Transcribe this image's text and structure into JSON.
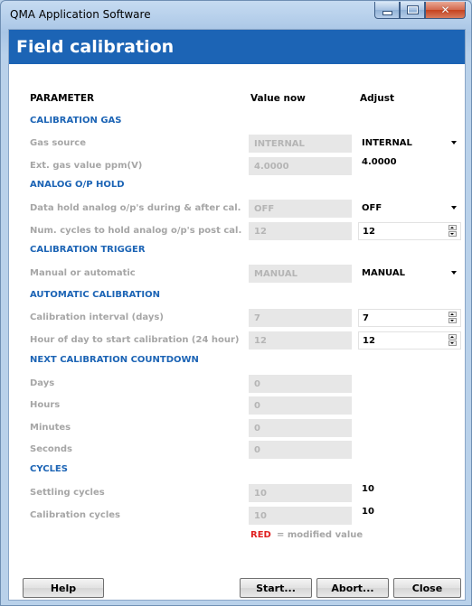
{
  "window": {
    "app_title": "QMA Application Software",
    "minimize": "minimize-icon",
    "maximize": "maximize-icon",
    "close": "close-icon"
  },
  "header": {
    "title": "Field calibration"
  },
  "columns": {
    "parameter": "PARAMETER",
    "value_now": "Value now",
    "adjust": "Adjust"
  },
  "sections": {
    "calibration_gas": "CALIBRATION GAS",
    "analog_hold": "ANALOG O/P HOLD",
    "calibration_trigger": "CALIBRATION TRIGGER",
    "automatic_calibration": "AUTOMATIC CALIBRATION",
    "next_countdown": "NEXT CALIBRATION COUNTDOWN",
    "cycles": "CYCLES"
  },
  "params": {
    "gas_source": {
      "label": "Gas source",
      "value_now": "INTERNAL",
      "adjust": "INTERNAL",
      "adjust_options": [
        "INTERNAL"
      ]
    },
    "ext_gas": {
      "label": "Ext. gas value ppm(V)",
      "value_now": "4.0000",
      "adjust": "4.0000"
    },
    "data_hold": {
      "label": "Data hold analog o/p's during & after cal.",
      "value_now": "OFF",
      "adjust": "OFF",
      "adjust_options": [
        "OFF"
      ]
    },
    "num_cycles_hold": {
      "label": "Num. cycles to hold analog o/p's post cal.",
      "value_now": "12",
      "adjust": "12"
    },
    "manual_auto": {
      "label": "Manual or automatic",
      "value_now": "MANUAL",
      "adjust": "MANUAL",
      "adjust_options": [
        "MANUAL"
      ]
    },
    "cal_interval": {
      "label": "Calibration interval (days)",
      "value_now": "7",
      "adjust": "7"
    },
    "hour_of_day": {
      "label": "Hour of day to start calibration (24 hour)",
      "value_now": "12",
      "adjust": "12"
    },
    "days": {
      "label": "Days",
      "value_now": "0"
    },
    "hours": {
      "label": "Hours",
      "value_now": "0"
    },
    "minutes": {
      "label": "Minutes",
      "value_now": "0"
    },
    "seconds": {
      "label": "Seconds",
      "value_now": "0"
    },
    "settling_cycles": {
      "label": "Settling cycles",
      "value_now": "10",
      "adjust": "10"
    },
    "calibration_cycles": {
      "label": "Calibration cycles",
      "value_now": "10",
      "adjust": "10"
    }
  },
  "legend": {
    "red": "RED",
    "text": "=  modified value"
  },
  "buttons": {
    "help": "Help",
    "start": "Start...",
    "abort": "Abort...",
    "close": "Close"
  },
  "colors": {
    "header": "#1c64b5",
    "section": "#1c64b5",
    "modified": "#e02020",
    "disabled_text": "#a6a6a6"
  }
}
